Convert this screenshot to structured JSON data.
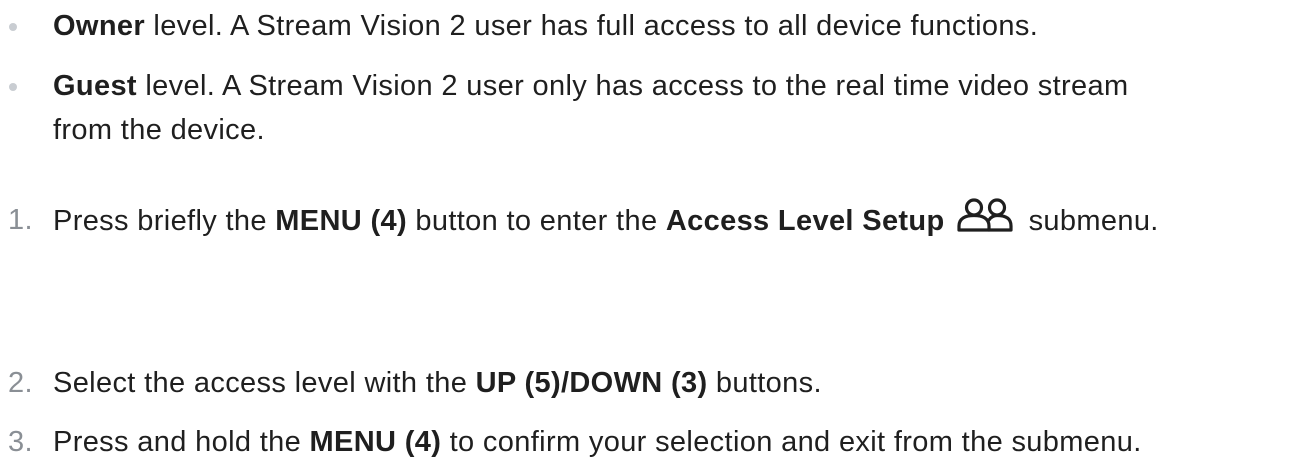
{
  "bullets": [
    {
      "bold": "Owner",
      "rest": " level.  A Stream Vision 2 user has full access to all device functions."
    },
    {
      "bold": "Guest",
      "rest_line1": " level. A Stream Vision 2 user only has access to the real time video stream",
      "rest_line2": "from the device."
    }
  ],
  "steps": [
    {
      "number": "1.",
      "t1": "Press briefly the ",
      "b1": "MENU (4)",
      "t2": " button to enter the ",
      "b2": "Access Level Setup",
      "icon": "users-icon",
      "t3": "submenu."
    },
    {
      "number": "2.",
      "t1": "Select the access level with the ",
      "b1": "UP (5)/DOWN (3)",
      "t2": " buttons."
    },
    {
      "number": "3.",
      "t1": "Press and hold the ",
      "b1": "MENU (4)",
      "t2": " to confirm your selection and exit from the submenu."
    }
  ]
}
